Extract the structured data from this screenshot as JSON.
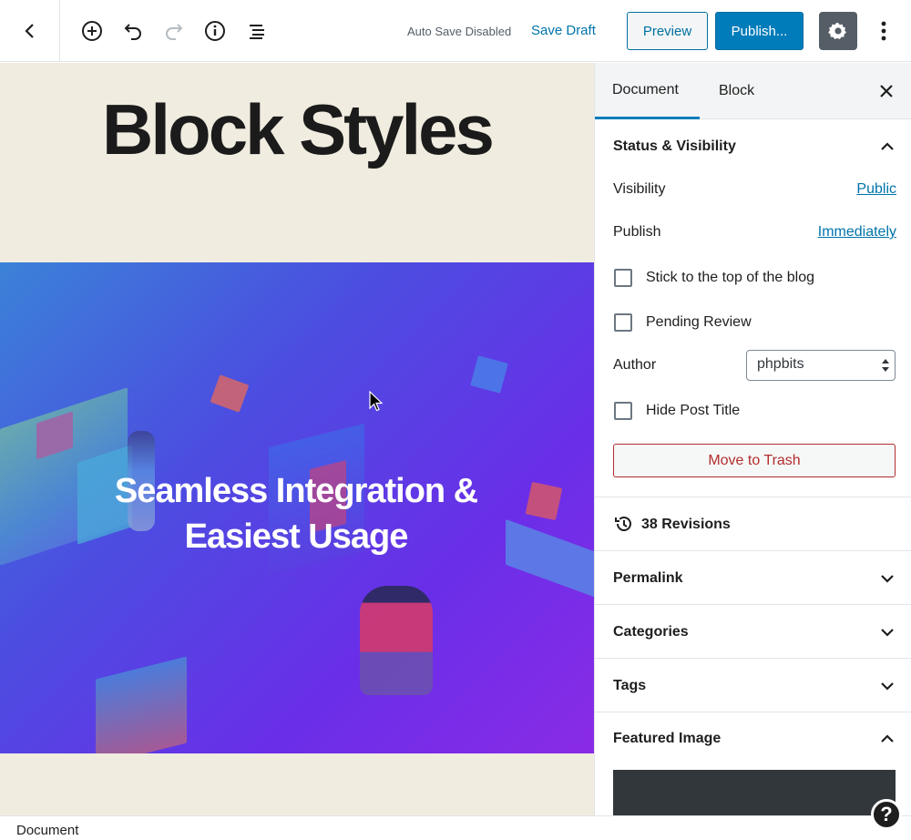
{
  "toolbar": {
    "auto_save": "Auto Save Disabled",
    "save_draft": "Save Draft",
    "preview": "Preview",
    "publish": "Publish..."
  },
  "editor": {
    "heading": "Block Styles",
    "cover_line1": "Seamless Integration &",
    "cover_line2": "Easiest Usage"
  },
  "sidebar": {
    "tabs": [
      "Document",
      "Block"
    ],
    "status_panel": {
      "title": "Status & Visibility",
      "visibility_label": "Visibility",
      "visibility_value": "Public",
      "publish_label": "Publish",
      "publish_value": "Immediately",
      "stick_label": "Stick to the top of the blog",
      "pending_label": "Pending Review",
      "author_label": "Author",
      "author_value": "phpbits",
      "hide_title_label": "Hide Post Title",
      "trash_label": "Move to Trash"
    },
    "revisions": "38 Revisions",
    "panels": [
      "Permalink",
      "Categories",
      "Tags",
      "Featured Image"
    ]
  },
  "footer": {
    "breadcrumb": "Document",
    "help": "?"
  },
  "colors": {
    "accent": "#007cba",
    "danger": "#b32d2e",
    "canvas_bg": "#f1ece0"
  }
}
